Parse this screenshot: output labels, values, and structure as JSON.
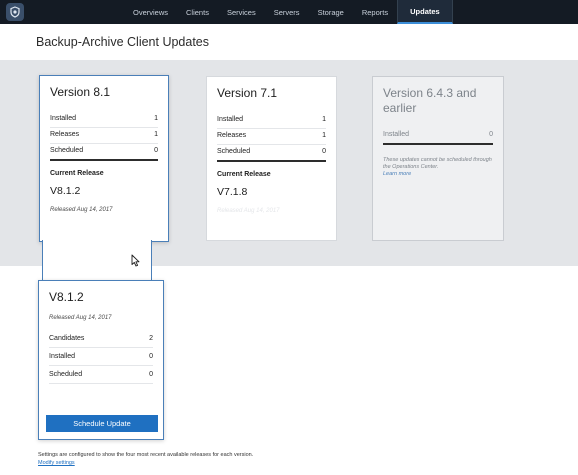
{
  "nav": {
    "logo_icon": "shield-logo-icon",
    "items": [
      {
        "label": "Overviews",
        "active": false
      },
      {
        "label": "Clients",
        "active": false
      },
      {
        "label": "Services",
        "active": false
      },
      {
        "label": "Servers",
        "active": false
      },
      {
        "label": "Storage",
        "active": false
      },
      {
        "label": "Reports",
        "active": false
      },
      {
        "label": "Updates",
        "active": true
      }
    ]
  },
  "page_title": "Backup-Archive Client Updates",
  "versions": [
    {
      "title": "Version 8.1",
      "rows": [
        {
          "label": "Installed",
          "value": "1"
        },
        {
          "label": "Releases",
          "value": "1"
        },
        {
          "label": "Scheduled",
          "value": "0"
        }
      ],
      "current_label": "Current Release",
      "current_version": "V8.1.2",
      "released": "Released Aug 14, 2017"
    },
    {
      "title": "Version 7.1",
      "rows": [
        {
          "label": "Installed",
          "value": "1"
        },
        {
          "label": "Releases",
          "value": "1"
        },
        {
          "label": "Scheduled",
          "value": "0"
        }
      ],
      "current_label": "Current Release",
      "current_version": "V7.1.8",
      "released": "Released Aug 14, 2017"
    },
    {
      "title": "Version 6.4.3 and earlier",
      "rows": [
        {
          "label": "Installed",
          "value": "0"
        }
      ],
      "note": "These updates cannot be scheduled through the Operations Center.",
      "note_link": "Learn more"
    }
  ],
  "details": {
    "title": "V8.1.2",
    "released": "Released Aug 14, 2017",
    "rows": [
      {
        "label": "Candidates",
        "value": "2"
      },
      {
        "label": "Installed",
        "value": "0"
      },
      {
        "label": "Scheduled",
        "value": "0"
      }
    ],
    "button_label": "Schedule Update"
  },
  "footer": {
    "text": "Settings are configured to show the four most recent available releases for each version.",
    "link": "Modify settings"
  },
  "colors": {
    "topbar": "#141b24",
    "accent": "#1f70c1",
    "selected_border": "#4a7fb8",
    "band": "#e3e5e8"
  }
}
